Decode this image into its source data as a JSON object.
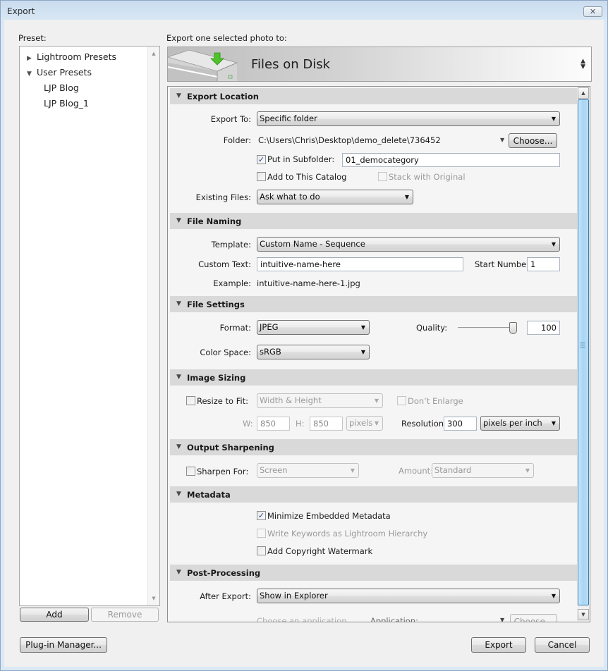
{
  "window": {
    "title": "Export",
    "close_icon": "close-icon"
  },
  "preset": {
    "label": "Preset:",
    "tree": [
      {
        "label": "Lightroom Presets",
        "expanded": false,
        "arrow": "▶"
      },
      {
        "label": "User Presets",
        "expanded": true,
        "arrow": "▼"
      },
      {
        "label": "LJP Blog"
      },
      {
        "label": "LJP Blog_1"
      }
    ],
    "add_label": "Add",
    "remove_label": "Remove"
  },
  "destination": {
    "label": "Export one selected photo to:",
    "value": "Files on Disk",
    "updown": "▲▼"
  },
  "sections": {
    "export_location": {
      "title": "Export Location",
      "export_to_label": "Export To:",
      "export_to_value": "Specific folder",
      "folder_label": "Folder:",
      "folder_value": "C:\\Users\\Chris\\Desktop\\demo_delete\\736452",
      "choose_label": "Choose...",
      "put_in_subfolder_label": "Put in Subfolder:",
      "put_in_subfolder_checked": true,
      "subfolder_value": "01_democategory",
      "add_to_catalog_label": "Add to This Catalog",
      "add_to_catalog_checked": false,
      "stack_with_original_label": "Stack with Original",
      "stack_with_original_checked": false,
      "existing_files_label": "Existing Files:",
      "existing_files_value": "Ask what to do"
    },
    "file_naming": {
      "title": "File Naming",
      "template_label": "Template:",
      "template_value": "Custom Name - Sequence",
      "custom_text_label": "Custom Text:",
      "custom_text_value": "intuitive-name-here",
      "start_number_label": "Start Number:",
      "start_number_value": "1",
      "example_label": "Example:",
      "example_value": "intuitive-name-here-1.jpg"
    },
    "file_settings": {
      "title": "File Settings",
      "format_label": "Format:",
      "format_value": "JPEG",
      "quality_label": "Quality:",
      "quality_value": "100",
      "quality_percent": 100,
      "color_space_label": "Color Space:",
      "color_space_value": "sRGB"
    },
    "image_sizing": {
      "title": "Image Sizing",
      "resize_label": "Resize to Fit:",
      "resize_checked": false,
      "resize_mode_value": "Width & Height",
      "dont_enlarge_label": "Don’t Enlarge",
      "dont_enlarge_checked": false,
      "w_label": "W:",
      "w_value": "850",
      "h_label": "H:",
      "h_value": "850",
      "unit_value": "pixels",
      "resolution_label": "Resolution:",
      "resolution_value": "300",
      "resolution_unit_value": "pixels per inch"
    },
    "output_sharpening": {
      "title": "Output Sharpening",
      "sharpen_label": "Sharpen For:",
      "sharpen_checked": false,
      "sharpen_value": "Screen",
      "amount_label": "Amount:",
      "amount_value": "Standard"
    },
    "metadata": {
      "title": "Metadata",
      "minimize_label": "Minimize Embedded Metadata",
      "minimize_checked": true,
      "keywords_label": "Write Keywords as Lightroom Hierarchy",
      "keywords_checked": false,
      "watermark_label": "Add Copyright Watermark",
      "watermark_checked": false
    },
    "post_processing": {
      "title": "Post-Processing",
      "after_export_label": "After Export:",
      "after_export_value": "Show in Explorer",
      "application_label": "Application:",
      "application_placeholder": "Choose an application...",
      "choose_label": "Choose..."
    }
  },
  "footer": {
    "plugin_manager_label": "Plug-in Manager...",
    "export_label": "Export",
    "cancel_label": "Cancel"
  },
  "glyphs": {
    "check": "✓",
    "caret": "▼",
    "section_open": "▼",
    "scroll_up": "▲",
    "scroll_down": "▼",
    "grip": "≡"
  }
}
